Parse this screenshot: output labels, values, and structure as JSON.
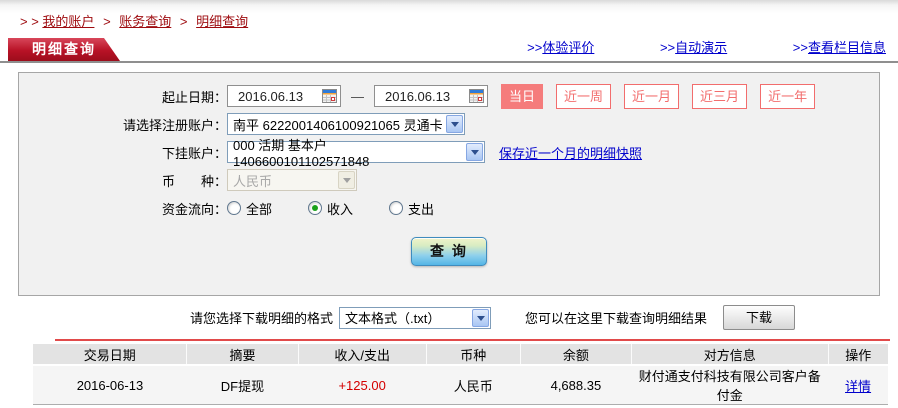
{
  "breadcrumb": {
    "prefix": "> >",
    "separator": ">",
    "items": [
      "我的账户",
      "账务查询",
      "明细查询"
    ]
  },
  "header": {
    "title": "明细查询",
    "links": [
      {
        "prefix": ">>",
        "label": "体验评价"
      },
      {
        "prefix": ">>",
        "label": "自动演示"
      },
      {
        "prefix": ">>",
        "label": "查看栏目信息"
      }
    ]
  },
  "form": {
    "date_label": "起止日期：",
    "date_from": "2016.06.13",
    "date_separator": "—",
    "date_to": "2016.06.13",
    "quick_buttons": [
      {
        "label": "当日",
        "active": true
      },
      {
        "label": "近一周",
        "active": false
      },
      {
        "label": "近一月",
        "active": false
      },
      {
        "label": "近三月",
        "active": false
      },
      {
        "label": "近一年",
        "active": false
      }
    ],
    "account_label": "请选择注册账户：",
    "account_value": "南平 6222001406100921065 灵通卡",
    "sub_account_label": "下挂账户：",
    "sub_account_value": "000 活期 基本户 1406600101102571848",
    "snapshot_link": "保存近一个月的明细快照",
    "currency_label": "币　　种：",
    "currency_value": "人民币",
    "flow_label": "资金流向：",
    "flow_options": [
      {
        "label": "全部",
        "checked": false
      },
      {
        "label": "收入",
        "checked": true
      },
      {
        "label": "支出",
        "checked": false
      }
    ],
    "query_button_label": "查 询"
  },
  "download": {
    "format_label": "请您选择下载明细的格式",
    "format_value": "文本格式（.txt）",
    "hint": "您可以在这里下载查询明细结果",
    "button_label": "下载"
  },
  "table": {
    "headers": [
      "交易日期",
      "摘要",
      "收入/支出",
      "币种",
      "余额",
      "对方信息",
      "操作"
    ],
    "rows": [
      {
        "date": "2016-06-13",
        "summary": "DF提现",
        "amount": "+125.00",
        "currency": "人民币",
        "balance": "4,688.35",
        "counterparty": "财付通支付科技有限公司客户备付金",
        "action": "详情"
      }
    ]
  },
  "colors": {
    "brand_red": "#b81226",
    "breadcrumb_red": "#9e0b0f",
    "link_blue": "#0000cc",
    "salmon_button": "#f57c7c",
    "amount_red": "#d40000",
    "table_separator_red": "#e14a4a",
    "query_button_blue": "#54b5e6"
  }
}
